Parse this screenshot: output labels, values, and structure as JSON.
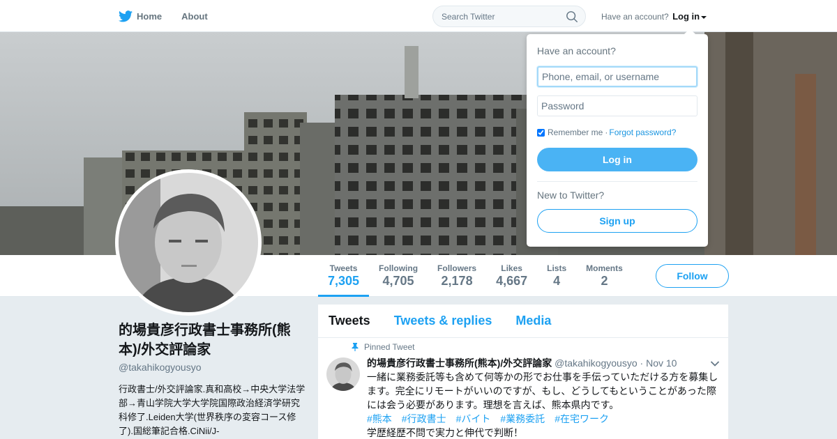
{
  "colors": {
    "brand": "#1da1f2",
    "login_button": "#4ab3f4",
    "page_bg": "#e6ecf0"
  },
  "nav": {
    "logo_icon": "twitter-bird-icon",
    "home_label": "Home",
    "about_label": "About",
    "search_placeholder": "Search Twitter",
    "search_icon": "search-icon",
    "have_account": "Have an account?",
    "login_label": "Log in"
  },
  "login_dropdown": {
    "title": "Have an account?",
    "username_placeholder": "Phone, email, or username",
    "password_placeholder": "Password",
    "remember_label": "Remember me",
    "separator": "·",
    "forgot_label": "Forgot password?",
    "login_button": "Log in",
    "new_label": "New to Twitter?",
    "signup_button": "Sign up"
  },
  "stats": [
    {
      "label": "Tweets",
      "value": "7,305"
    },
    {
      "label": "Following",
      "value": "4,705"
    },
    {
      "label": "Followers",
      "value": "2,178"
    },
    {
      "label": "Likes",
      "value": "4,667"
    },
    {
      "label": "Lists",
      "value": "4"
    },
    {
      "label": "Moments",
      "value": "2"
    }
  ],
  "follow_button": "Follow",
  "profile": {
    "name": "的場貴彦行政書士事務所(熊本)/外交評論家",
    "handle": "@takahikogyousyo",
    "bio": "行政書士/外交評論家.真和高校→中央大学法学部→青山学院大学大学院国際政治経済学研究科修了.Leiden大学(世界秩序の変容コース修了).国総筆記合格.CiNii/J-"
  },
  "timeline": {
    "tabs": [
      "Tweets",
      "Tweets & replies",
      "Media"
    ],
    "pinned_label": "Pinned Tweet",
    "tweet": {
      "fullname": "的場貴彦行政書士事務所(熊本)/外交評論家",
      "handle": "@takahikogyousyo",
      "dot": "·",
      "date": "Nov 10",
      "text": "一緒に業務委託等も含めて何等かの形でお仕事を手伝っていただける方を募集します。完全にリモートがいいのですが、もし、どうしてもということがあった際には会う必要があります。理想を言えば、熊本県内です。",
      "hashtags": [
        "#熊本",
        "#行政書士",
        "#バイト",
        "#業務委託",
        "#在宅ワーク"
      ],
      "text2": "学歴経歴不問で実力と伸代で判断！"
    }
  }
}
